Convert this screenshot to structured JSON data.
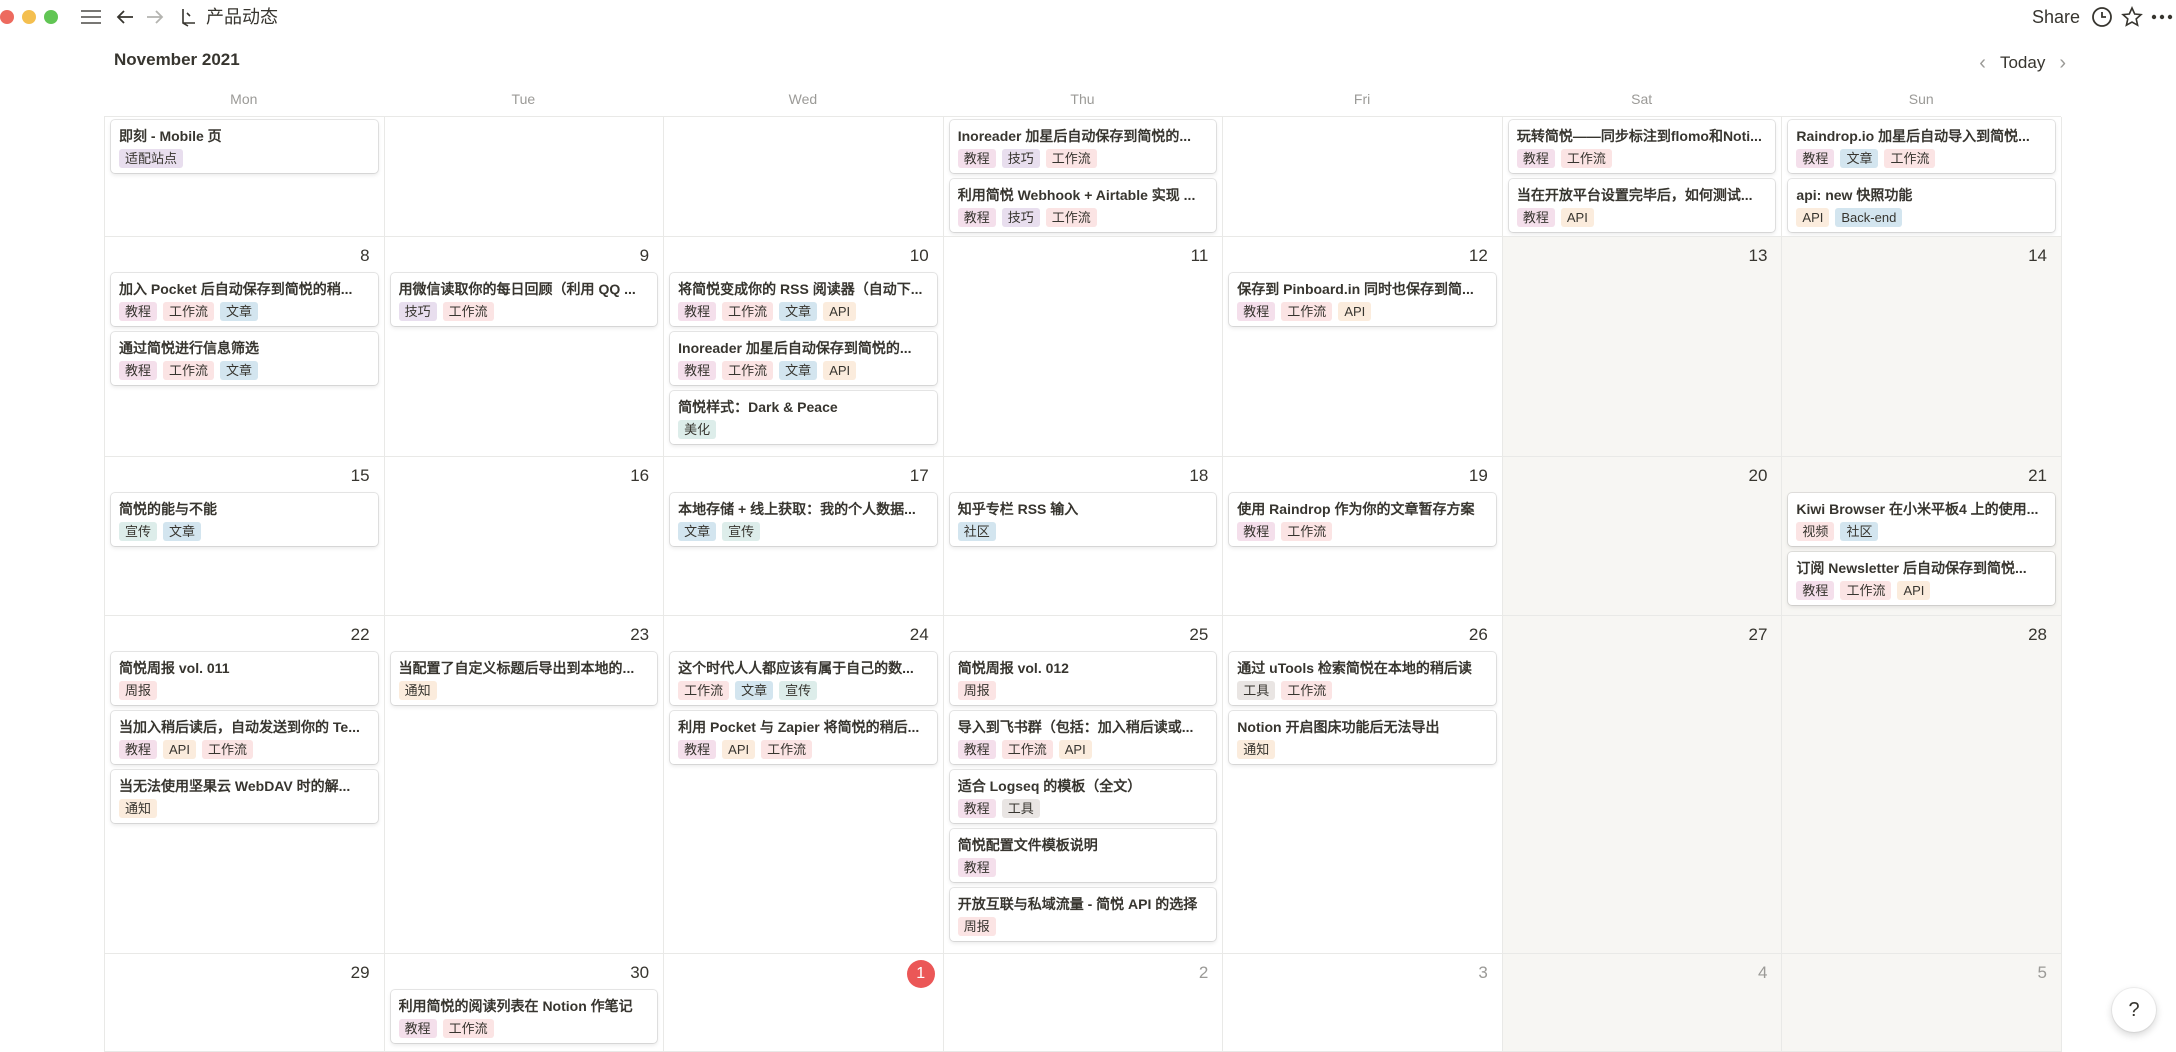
{
  "window": {
    "breadcrumb_title": "产品动态",
    "share_label": "Share"
  },
  "calendar": {
    "month_title": "November 2021",
    "today_label": "Today",
    "weekdays": [
      "Mon",
      "Tue",
      "Wed",
      "Thu",
      "Fri",
      "Sat",
      "Sun"
    ]
  },
  "tag_colors": {
    "适配站点": "#e8deee",
    "教程": "#f4dfeb",
    "技巧": "#e8deee",
    "工作流": "#fbe4e4",
    "文章": "#d3e5ef",
    "API": "#fbecdd",
    "Back-end": "#d3e5ef",
    "美化": "#ddedea",
    "宣传": "#ddedea",
    "社区": "#d3e5ef",
    "视频": "#fbe4e4",
    "周报": "#fbe4e4",
    "通知": "#fbecdd",
    "工具": "#e9e5e3"
  },
  "weeks": [
    [
      {
        "day": "",
        "muted": false,
        "weekend": false,
        "first_row": true,
        "today": false,
        "events": [
          {
            "title": "即刻 - Mobile 页",
            "tags": [
              "适配站点"
            ]
          }
        ]
      },
      {
        "day": "",
        "muted": false,
        "weekend": false,
        "first_row": true,
        "today": false,
        "events": []
      },
      {
        "day": "",
        "muted": false,
        "weekend": false,
        "first_row": true,
        "today": false,
        "events": []
      },
      {
        "day": "",
        "muted": false,
        "weekend": false,
        "first_row": true,
        "today": false,
        "events": [
          {
            "title": "Inoreader 加星后自动保存到简悦的...",
            "tags": [
              "教程",
              "技巧",
              "工作流"
            ]
          },
          {
            "title": "利用简悦 Webhook + Airtable 实现 ...",
            "tags": [
              "教程",
              "技巧",
              "工作流"
            ]
          }
        ]
      },
      {
        "day": "",
        "muted": false,
        "weekend": false,
        "first_row": true,
        "today": false,
        "events": []
      },
      {
        "day": "",
        "muted": false,
        "weekend": false,
        "first_row": true,
        "today": false,
        "events": [
          {
            "title": "玩转简悦——同步标注到flomo和Noti...",
            "tags": [
              "教程",
              "工作流"
            ]
          },
          {
            "title": "当在开放平台设置完毕后，如何测试...",
            "tags": [
              "教程",
              "API"
            ]
          }
        ]
      },
      {
        "day": "",
        "muted": false,
        "weekend": false,
        "first_row": true,
        "today": false,
        "events": [
          {
            "title": "Raindrop.io 加星后自动导入到简悦...",
            "tags": [
              "教程",
              "文章",
              "工作流"
            ]
          },
          {
            "title": "api: new 快照功能",
            "tags": [
              "API",
              "Back-end"
            ]
          }
        ]
      }
    ],
    [
      {
        "day": "8",
        "muted": false,
        "weekend": false,
        "first_row": false,
        "today": false,
        "events": [
          {
            "title": "加入 Pocket 后自动保存到简悦的稍...",
            "tags": [
              "教程",
              "工作流",
              "文章"
            ]
          },
          {
            "title": "通过简悦进行信息筛选",
            "tags": [
              "教程",
              "工作流",
              "文章"
            ]
          }
        ]
      },
      {
        "day": "9",
        "muted": false,
        "weekend": false,
        "first_row": false,
        "today": false,
        "events": [
          {
            "title": "用微信读取你的每日回顾（利用 QQ ...",
            "tags": [
              "技巧",
              "工作流"
            ]
          }
        ]
      },
      {
        "day": "10",
        "muted": false,
        "weekend": false,
        "first_row": false,
        "today": false,
        "events": [
          {
            "title": "将简悦变成你的 RSS 阅读器（自动下...",
            "tags": [
              "教程",
              "工作流",
              "文章",
              "API"
            ]
          },
          {
            "title": "Inoreader 加星后自动保存到简悦的...",
            "tags": [
              "教程",
              "工作流",
              "文章",
              "API"
            ]
          },
          {
            "title": "简悦样式：Dark & Peace",
            "tags": [
              "美化"
            ]
          }
        ]
      },
      {
        "day": "11",
        "muted": false,
        "weekend": false,
        "first_row": false,
        "today": false,
        "events": []
      },
      {
        "day": "12",
        "muted": false,
        "weekend": false,
        "first_row": false,
        "today": false,
        "events": [
          {
            "title": "保存到 Pinboard.in 同时也保存到简...",
            "tags": [
              "教程",
              "工作流",
              "API"
            ]
          }
        ]
      },
      {
        "day": "13",
        "muted": false,
        "weekend": true,
        "first_row": false,
        "today": false,
        "events": []
      },
      {
        "day": "14",
        "muted": false,
        "weekend": true,
        "first_row": false,
        "today": false,
        "events": []
      }
    ],
    [
      {
        "day": "15",
        "muted": false,
        "weekend": false,
        "first_row": false,
        "today": false,
        "events": [
          {
            "title": "简悦的能与不能",
            "tags": [
              "宣传",
              "文章"
            ]
          }
        ]
      },
      {
        "day": "16",
        "muted": false,
        "weekend": false,
        "first_row": false,
        "today": false,
        "events": []
      },
      {
        "day": "17",
        "muted": false,
        "weekend": false,
        "first_row": false,
        "today": false,
        "events": [
          {
            "title": "本地存储 + 线上获取：我的个人数据...",
            "tags": [
              "文章",
              "宣传"
            ]
          }
        ]
      },
      {
        "day": "18",
        "muted": false,
        "weekend": false,
        "first_row": false,
        "today": false,
        "events": [
          {
            "title": "知乎专栏 RSS 输入",
            "tags": [
              "社区"
            ]
          }
        ]
      },
      {
        "day": "19",
        "muted": false,
        "weekend": false,
        "first_row": false,
        "today": false,
        "events": [
          {
            "title": "使用 Raindrop 作为你的文章暂存方案",
            "tags": [
              "教程",
              "工作流"
            ]
          }
        ]
      },
      {
        "day": "20",
        "muted": false,
        "weekend": true,
        "first_row": false,
        "today": false,
        "events": []
      },
      {
        "day": "21",
        "muted": false,
        "weekend": true,
        "first_row": false,
        "today": false,
        "events": [
          {
            "title": "Kiwi Browser 在小米平板4 上的使用...",
            "tags": [
              "视频",
              "社区"
            ]
          },
          {
            "title": "订阅 Newsletter 后自动保存到简悦...",
            "tags": [
              "教程",
              "工作流",
              "API"
            ]
          }
        ]
      }
    ],
    [
      {
        "day": "22",
        "muted": false,
        "weekend": false,
        "first_row": false,
        "today": false,
        "events": [
          {
            "title": "简悦周报 vol. 011",
            "tags": [
              "周报"
            ]
          },
          {
            "title": "当加入稍后读后，自动发送到你的 Te...",
            "tags": [
              "教程",
              "API",
              "工作流"
            ]
          },
          {
            "title": "当无法使用坚果云 WebDAV 时的解...",
            "tags": [
              "通知"
            ]
          }
        ]
      },
      {
        "day": "23",
        "muted": false,
        "weekend": false,
        "first_row": false,
        "today": false,
        "events": [
          {
            "title": "当配置了自定义标题后导出到本地的...",
            "tags": [
              "通知"
            ]
          }
        ]
      },
      {
        "day": "24",
        "muted": false,
        "weekend": false,
        "first_row": false,
        "today": false,
        "events": [
          {
            "title": "这个时代人人都应该有属于自己的数...",
            "tags": [
              "工作流",
              "文章",
              "宣传"
            ]
          },
          {
            "title": "利用 Pocket 与 Zapier 将简悦的稍后...",
            "tags": [
              "教程",
              "API",
              "工作流"
            ]
          }
        ]
      },
      {
        "day": "25",
        "muted": false,
        "weekend": false,
        "first_row": false,
        "today": false,
        "events": [
          {
            "title": "简悦周报 vol. 012",
            "tags": [
              "周报"
            ]
          },
          {
            "title": "导入到飞书群（包括：加入稍后读或...",
            "tags": [
              "教程",
              "工作流",
              "API"
            ]
          },
          {
            "title": "适合 Logseq 的模板（全文）",
            "tags": [
              "教程",
              "工具"
            ]
          },
          {
            "title": "简悦配置文件模板说明",
            "tags": [
              "教程"
            ]
          },
          {
            "title": "开放互联与私域流量 - 简悦 API 的选择",
            "tags": [
              "周报"
            ]
          }
        ]
      },
      {
        "day": "26",
        "muted": false,
        "weekend": false,
        "first_row": false,
        "today": false,
        "events": [
          {
            "title": "通过 uTools 检索简悦在本地的稍后读",
            "tags": [
              "工具",
              "工作流"
            ]
          },
          {
            "title": "Notion 开启图床功能后无法导出",
            "tags": [
              "通知"
            ]
          }
        ]
      },
      {
        "day": "27",
        "muted": false,
        "weekend": true,
        "first_row": false,
        "today": false,
        "events": []
      },
      {
        "day": "28",
        "muted": false,
        "weekend": true,
        "first_row": false,
        "today": false,
        "events": []
      }
    ],
    [
      {
        "day": "29",
        "muted": false,
        "weekend": false,
        "first_row": false,
        "today": false,
        "events": []
      },
      {
        "day": "30",
        "muted": false,
        "weekend": false,
        "first_row": false,
        "today": false,
        "events": [
          {
            "title": "利用简悦的阅读列表在 Notion 作笔记",
            "tags": [
              "教程",
              "工作流"
            ]
          }
        ]
      },
      {
        "day": "1",
        "muted": false,
        "weekend": false,
        "first_row": false,
        "today": true,
        "events": []
      },
      {
        "day": "2",
        "muted": true,
        "weekend": false,
        "first_row": false,
        "today": false,
        "events": []
      },
      {
        "day": "3",
        "muted": true,
        "weekend": false,
        "first_row": false,
        "today": false,
        "events": []
      },
      {
        "day": "4",
        "muted": true,
        "weekend": true,
        "first_row": false,
        "today": false,
        "events": []
      },
      {
        "day": "5",
        "muted": true,
        "weekend": true,
        "first_row": false,
        "today": false,
        "events": []
      }
    ]
  ],
  "help_label": "?"
}
